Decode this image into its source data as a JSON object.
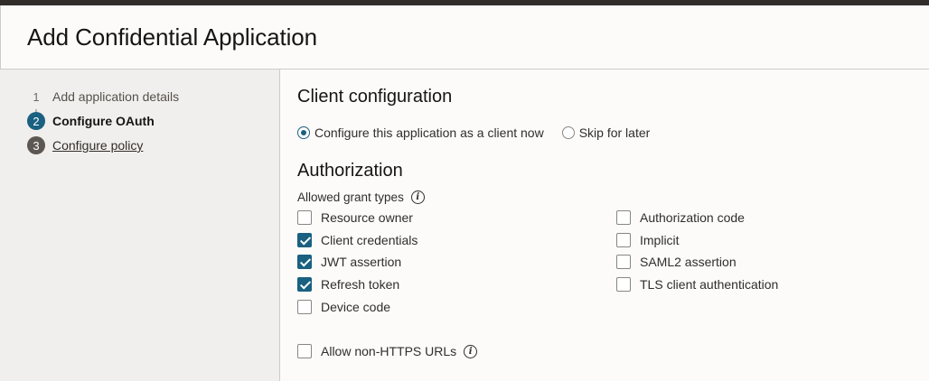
{
  "header": {
    "title": "Add Confidential Application"
  },
  "steps": [
    {
      "num": "1",
      "label": "Add application details"
    },
    {
      "num": "2",
      "label": "Configure OAuth"
    },
    {
      "num": "3",
      "label": "Configure policy"
    }
  ],
  "client_config": {
    "title": "Client configuration",
    "options": [
      {
        "label": "Configure this application as a client now",
        "selected": true
      },
      {
        "label": "Skip for later",
        "selected": false
      }
    ]
  },
  "authorization": {
    "title": "Authorization",
    "grant_types_label": "Allowed grant types",
    "grants_left": [
      {
        "label": "Resource owner",
        "checked": false
      },
      {
        "label": "Client credentials",
        "checked": true
      },
      {
        "label": "JWT assertion",
        "checked": true
      },
      {
        "label": "Refresh token",
        "checked": true
      },
      {
        "label": "Device code",
        "checked": false
      }
    ],
    "grants_right": [
      {
        "label": "Authorization code",
        "checked": false
      },
      {
        "label": "Implicit",
        "checked": false
      },
      {
        "label": "SAML2 assertion",
        "checked": false
      },
      {
        "label": "TLS client authentication",
        "checked": false
      }
    ],
    "allow_non_https": {
      "label": "Allow non-HTTPS URLs",
      "checked": false
    }
  },
  "info_glyph": "i",
  "colors": {
    "accent": "#1a6080",
    "sidebar": "#f1efed",
    "topbar": "#312d2a"
  }
}
